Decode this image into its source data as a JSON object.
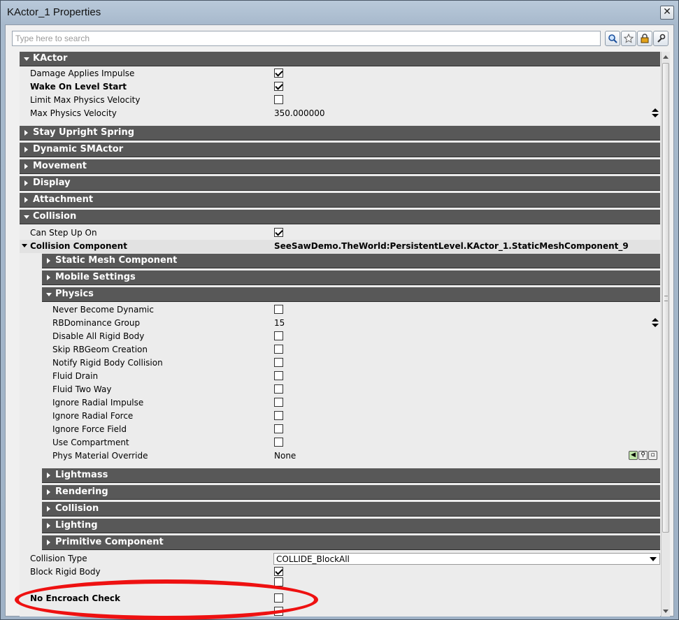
{
  "window": {
    "title": "KActor_1 Properties",
    "close_glyph": "✕"
  },
  "search": {
    "placeholder": "Type here to search",
    "value": ""
  },
  "toolbar": {
    "icons": [
      "search-icon",
      "favorites-star-icon",
      "lock-icon",
      "wrench-icon"
    ]
  },
  "categories": {
    "kactor": "KActor",
    "stay_upright_spring": "Stay Upright Spring",
    "dynamic_smactor": "Dynamic SMActor",
    "movement": "Movement",
    "display": "Display",
    "attachment": "Attachment",
    "collision": "Collision"
  },
  "kactor_props": {
    "damage_applies_impulse": "Damage Applies Impulse",
    "wake_on_level_start": "Wake On Level Start",
    "limit_max_physics_velocity": "Limit Max Physics Velocity",
    "max_physics_velocity": "Max Physics Velocity",
    "max_physics_velocity_value": "350.000000"
  },
  "collision_props": {
    "can_step_up_on": "Can Step Up On",
    "collision_component": "Collision Component",
    "collision_component_value": "SeeSawDemo.TheWorld:PersistentLevel.KActor_1.StaticMeshComponent_9",
    "collision_type": "Collision Type",
    "collision_type_value": "COLLIDE_BlockAll",
    "block_rigid_body": "Block Rigid Body",
    "no_encroach_check": "No Encroach Check"
  },
  "subcategories": {
    "static_mesh_component": "Static Mesh Component",
    "mobile_settings": "Mobile Settings",
    "physics": "Physics",
    "lightmass": "Lightmass",
    "rendering": "Rendering",
    "collision": "Collision",
    "lighting": "Lighting",
    "primitive_component": "Primitive Component"
  },
  "physics_props": {
    "never_become_dynamic": "Never Become Dynamic",
    "rbdominance_group": "RBDominance Group",
    "rbdominance_value": "15",
    "disable_all_rigid_body": "Disable All Rigid Body",
    "skip_rbgeom_creation": "Skip RBGeom Creation",
    "notify_rigid_body_collision": "Notify Rigid Body Collision",
    "fluid_drain": "Fluid Drain",
    "fluid_two_way": "Fluid Two Way",
    "ignore_radial_impulse": "Ignore Radial Impulse",
    "ignore_radial_force": "Ignore Radial Force",
    "ignore_force_field": "Ignore Force Field",
    "use_compartment": "Use Compartment",
    "phys_material_override": "Phys Material Override",
    "phys_material_value": "None"
  },
  "checkbox_states": {
    "damage_applies_impulse": true,
    "wake_on_level_start": true,
    "limit_max_physics_velocity": false,
    "can_step_up_on": true,
    "never_become_dynamic": false,
    "disable_all_rigid_body": false,
    "skip_rbgeom_creation": false,
    "notify_rigid_body_collision": false,
    "fluid_drain": false,
    "fluid_two_way": false,
    "ignore_radial_impulse": false,
    "ignore_radial_force": false,
    "ignore_force_field": false,
    "use_compartment": false,
    "block_rigid_body": true,
    "no_encroach_check": false
  },
  "colors": {
    "category_bar": "#585858",
    "annotation": "#ee1111"
  }
}
